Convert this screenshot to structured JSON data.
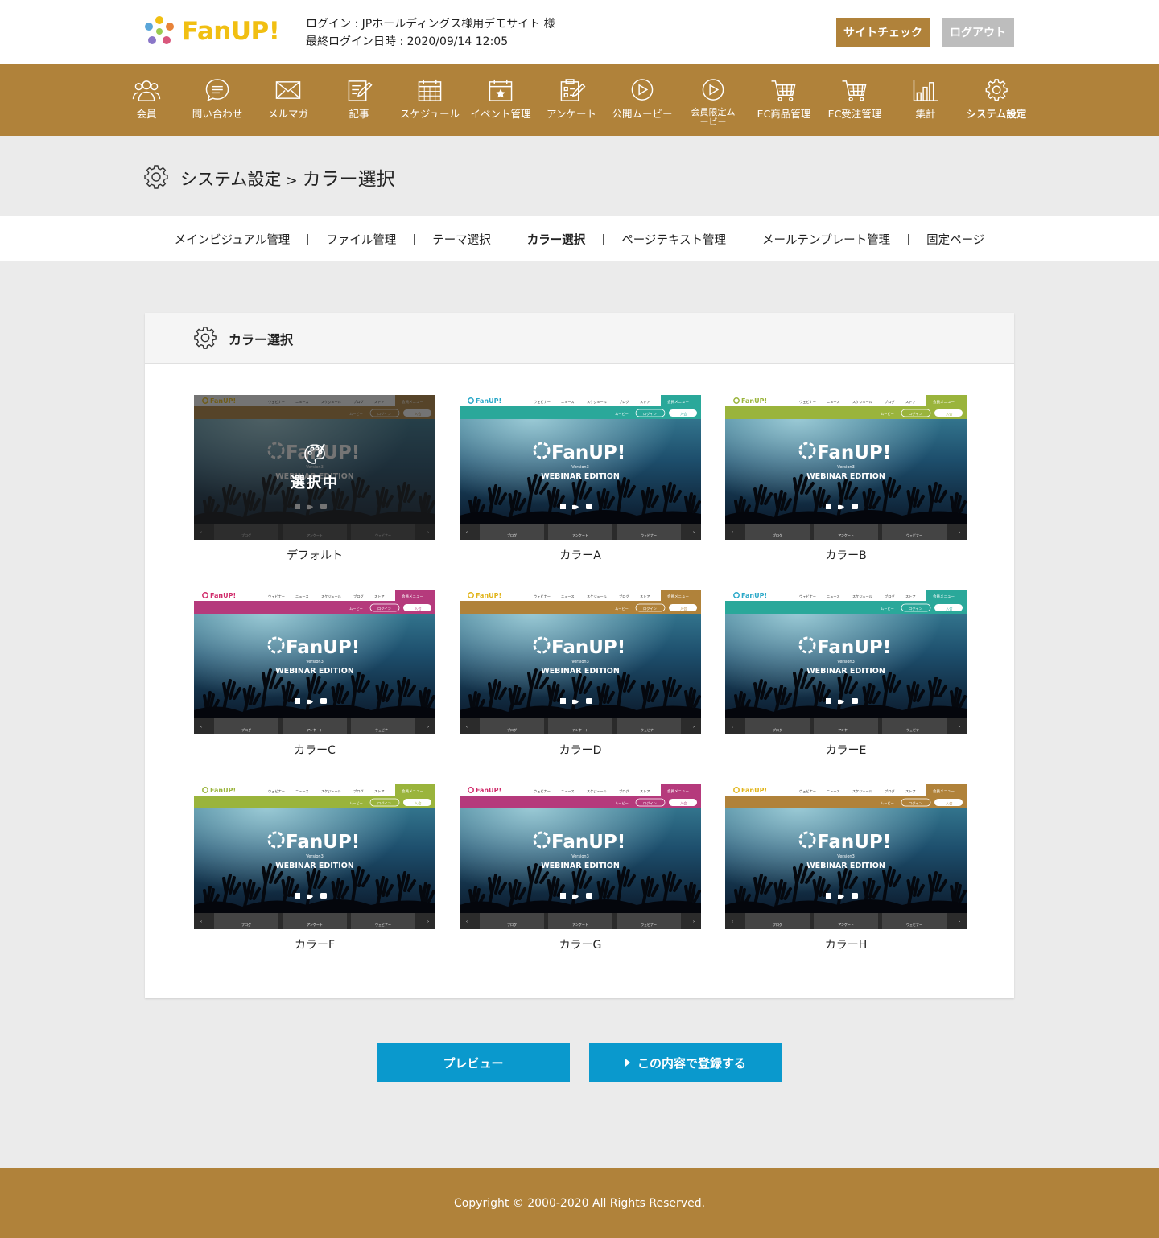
{
  "app": {
    "logo_text": "FanUP!"
  },
  "header": {
    "login_line": "ログイン : JPホールディングス様用デモサイト 様",
    "last_login_line": "最終ログイン日時 : 2020/09/14 12:05",
    "site_check_label": "サイトチェック",
    "logout_label": "ログアウト"
  },
  "nav": {
    "items": [
      {
        "label": "会員",
        "icon": "users-icon"
      },
      {
        "label": "問い合わせ",
        "icon": "chat-bubble-icon"
      },
      {
        "label": "メルマガ",
        "icon": "mail-icon"
      },
      {
        "label": "記事",
        "icon": "edit-document-icon"
      },
      {
        "label": "スケジュール",
        "icon": "calendar-icon"
      },
      {
        "label": "イベント管理",
        "icon": "calendar-star-icon"
      },
      {
        "label": "アンケート",
        "icon": "survey-icon"
      },
      {
        "label": "公開ムービー",
        "icon": "play-icon"
      },
      {
        "label": "会員限定ムービー",
        "icon": "play-icon"
      },
      {
        "label": "EC商品管理",
        "icon": "cart-icon"
      },
      {
        "label": "EC受注管理",
        "icon": "cart-icon"
      },
      {
        "label": "集計",
        "icon": "bar-chart-icon"
      },
      {
        "label": "システム設定",
        "icon": "gear-icon"
      }
    ],
    "active": "システム設定"
  },
  "page": {
    "breadcrumb_parent": "システム設定",
    "breadcrumb_sep": ">",
    "breadcrumb_current": "カラー選択"
  },
  "subnav": {
    "items": [
      "メインビジュアル管理",
      "ファイル管理",
      "テーマ選択",
      "カラー選択",
      "ページテキスト管理",
      "メールテンプレート管理",
      "固定ページ"
    ],
    "active": "カラー選択"
  },
  "panel": {
    "title": "カラー選択",
    "selected_text": "選択中",
    "thumb_text": {
      "logo": "FanUP!",
      "version": "Version3",
      "edition": "WEBINAR EDITION",
      "member_menu": "会員メニュー",
      "menu_items": [
        "ウェビナー",
        "ニュース",
        "スケジュール",
        "ブログ",
        "ストア"
      ],
      "sub_items": [
        "ムービー",
        "ログイン",
        "入会"
      ],
      "bottom_tabs": [
        "ブログ",
        "アンケート",
        "ウェビナー"
      ]
    },
    "options": [
      {
        "label": "デフォルト",
        "color": "#b0823a",
        "logo_color": "#f1bf12",
        "selected": true
      },
      {
        "label": "カラーA",
        "color": "#2aa89a",
        "logo_color": "#2aa8c8",
        "selected": false
      },
      {
        "label": "カラーB",
        "color": "#9ab43c",
        "logo_color": "#9ab43c",
        "selected": false
      },
      {
        "label": "カラーC",
        "color": "#b53a7c",
        "logo_color": "#d02a6a",
        "selected": false
      },
      {
        "label": "カラーD",
        "color": "#b0823a",
        "logo_color": "#e1b41a",
        "selected": false
      },
      {
        "label": "カラーE",
        "color": "#2aa89a",
        "logo_color": "#2aa8c8",
        "selected": false
      },
      {
        "label": "カラーF",
        "color": "#9ab43c",
        "logo_color": "#9ab43c",
        "selected": false
      },
      {
        "label": "カラーG",
        "color": "#b53a7c",
        "logo_color": "#d02a6a",
        "selected": false
      },
      {
        "label": "カラーH",
        "color": "#b0823a",
        "logo_color": "#e1b41a",
        "selected": false
      }
    ]
  },
  "actions": {
    "preview_label": "プレビュー",
    "register_label": "この内容で登録する"
  },
  "footer": {
    "copyright": "Copyright © 2000-2020 All Rights Reserved."
  },
  "colors": {
    "brand": "#b0823a",
    "button_blue": "#0a99cd",
    "logout_gray": "#bdbdbd",
    "page_bg": "#ebebeb"
  }
}
